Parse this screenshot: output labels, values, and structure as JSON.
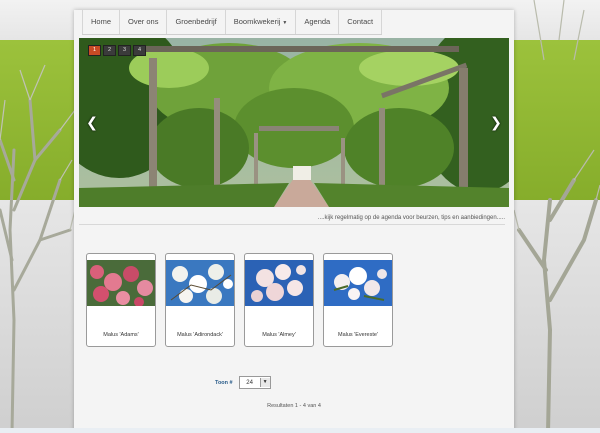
{
  "nav": {
    "items": [
      {
        "label": "Home"
      },
      {
        "label": "Over ons"
      },
      {
        "label": "Groenbedrijf"
      },
      {
        "label": "Boomkwekerij",
        "has_dropdown": true
      },
      {
        "label": "Agenda"
      },
      {
        "label": "Contact"
      }
    ]
  },
  "slider": {
    "dots": [
      "1",
      "2",
      "3",
      "4"
    ],
    "active_dot": "1",
    "prev_icon": "chevron-left-icon",
    "next_icon": "chevron-right-icon"
  },
  "tagline": "....kijk regelmatig op de agenda voor beurzen, tips en aanbiedingen.....",
  "products": [
    {
      "name": "Malus 'Adams'"
    },
    {
      "name": "Malus 'Adirondack'"
    },
    {
      "name": "Malus 'Almey'"
    },
    {
      "name": "Malus 'Evereste'"
    }
  ],
  "pager": {
    "label": "Toon #",
    "selected": "24"
  },
  "results": "Resultaten 1 - 4 van 4",
  "colors": {
    "green_band": "#9cc23c",
    "active_dot": "#c84a25",
    "link_blue": "#2a5c8a"
  }
}
